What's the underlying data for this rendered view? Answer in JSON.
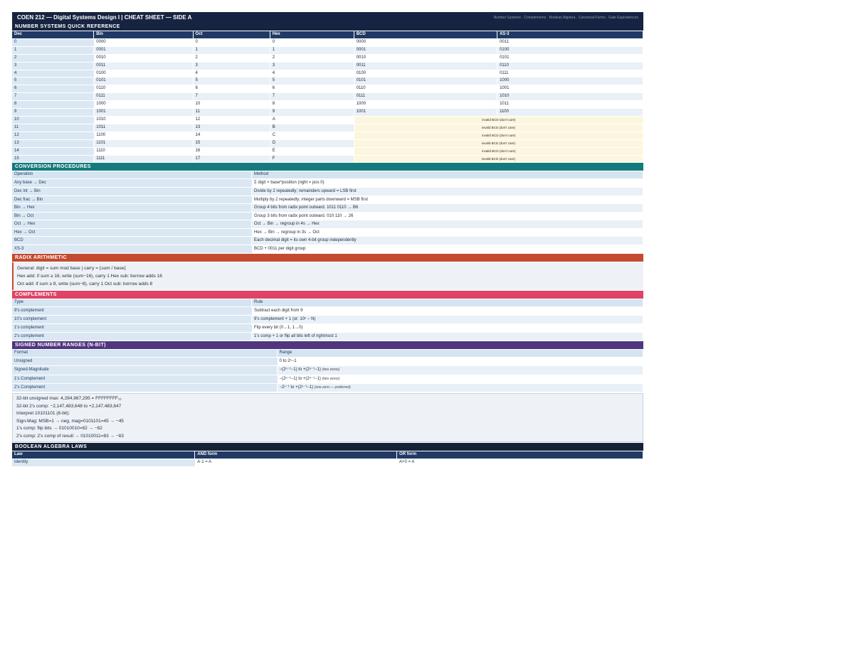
{
  "header": {
    "title": "COEN 212 — Digital Systems Design I  |  CHEAT SHEET — SIDE A",
    "nav": "Number Systems · Complements · Boolean Algebra · Canonical Forms · Gate Equivalences"
  },
  "number_systems": {
    "title": "NUMBER SYSTEMS QUICK REFERENCE",
    "headers": [
      "Dec",
      "Bin",
      "Oct",
      "Hex",
      "BCD",
      "XS-3"
    ],
    "rows": [
      [
        "0",
        "0000",
        "0",
        "0",
        "0000",
        "0011"
      ],
      [
        "1",
        "0001",
        "1",
        "1",
        "0001",
        "0100"
      ],
      [
        "2",
        "0010",
        "2",
        "2",
        "0010",
        "0101"
      ],
      [
        "3",
        "0011",
        "3",
        "3",
        "0011",
        "0110"
      ],
      [
        "4",
        "0100",
        "4",
        "4",
        "0100",
        "0111"
      ],
      [
        "5",
        "0101",
        "5",
        "5",
        "0101",
        "1000"
      ],
      [
        "6",
        "0110",
        "6",
        "6",
        "0110",
        "1001"
      ],
      [
        "7",
        "0111",
        "7",
        "7",
        "0111",
        "1010"
      ],
      [
        "8",
        "1000",
        "10",
        "8",
        "1000",
        "1011"
      ],
      [
        "9",
        "1001",
        "11",
        "9",
        "1001",
        "1100"
      ],
      [
        "10",
        "1010",
        "12",
        "A",
        "invalid BCD (don't care)"
      ],
      [
        "11",
        "1011",
        "13",
        "B",
        "invalid BCD (don't care)"
      ],
      [
        "12",
        "1100",
        "14",
        "C",
        "invalid BCD (don't care)"
      ],
      [
        "13",
        "1101",
        "15",
        "D",
        "invalid BCD (don't care)"
      ],
      [
        "14",
        "1110",
        "16",
        "E",
        "invalid BCD (don't care)"
      ],
      [
        "15",
        "1111",
        "17",
        "F",
        "invalid BCD (don't care)"
      ]
    ]
  },
  "conversion": {
    "title": "CONVERSION PROCEDURES",
    "headers": [
      "Operation",
      "Method"
    ],
    "rows": [
      [
        "Any base → Dec",
        "Σ digit × base^position (right = pos 0)"
      ],
      [
        "Dec int → Bin",
        "Divide by 2 repeatedly; remainders upward = LSB first"
      ],
      [
        "Dec frac → Bin",
        "Multiply by 2 repeatedly; integer parts downward = MSB first"
      ],
      [
        "Bin → Hex",
        "Group 4 bits from radix point outward. 1011 0110 → B6"
      ],
      [
        "Bin → Oct",
        "Group 3 bits from radix point outward. 010 110 → 26"
      ],
      [
        "Oct → Hex",
        "Oct → Bin → regroup in 4s → Hex"
      ],
      [
        "Hex → Oct",
        "Hex → Bin → regroup in 3s → Oct"
      ],
      [
        "BCD",
        "Each decimal digit = its own 4-bit group independently"
      ],
      [
        "XS-3",
        "BCD + 0011 per digit group"
      ]
    ]
  },
  "radix": {
    "title": "RADIX ARITHMETIC",
    "lines": [
      "General: digit = sum mod base  |  carry = ⌊sum / base⌋",
      "Hex add: if sum ≥ 16, write (sum−16), carry 1     Hex sub: borrow adds 16",
      "Oct add: if sum ≥ 8, write (sum−8), carry 1     Oct sub: borrow adds 8"
    ]
  },
  "complements": {
    "title": "COMPLEMENTS",
    "headers": [
      "Type",
      "Rule"
    ],
    "rows": [
      [
        "9's complement",
        "Subtract each digit from 9"
      ],
      [
        "10's complement",
        "9's complement + 1   (or: 10ⁿ − N)"
      ],
      [
        "1's complement",
        "Flip every bit  (0→1, 1→0)"
      ],
      [
        "2's complement",
        "1's comp + 1   or   flip all bits left of rightmost 1"
      ]
    ]
  },
  "signed": {
    "title": "SIGNED NUMBER RANGES (N-BIT)",
    "headers": [
      "Format",
      "Range"
    ],
    "rows": [
      [
        "Unsigned",
        "0 to 2ⁿ−1",
        ""
      ],
      [
        "Signed-Magnitude",
        "−(2ⁿ⁻¹−1) to +(2ⁿ⁻¹−1)",
        "(two zeros)"
      ],
      [
        "1's Complement",
        "−(2ⁿ⁻¹−1) to +(2ⁿ⁻¹−1)",
        "(two zeros)"
      ],
      [
        "2's Complement",
        "−2ⁿ⁻¹ to +(2ⁿ⁻¹−1)",
        "(one zero — preferred)"
      ]
    ],
    "notes": [
      "32-bit unsigned max: 4,294,967,295 = FFFFFFFF₁₆",
      "32-bit 2's comp: −2,147,483,648 to +2,147,483,647",
      "Interpret 10101101 (8-bit):",
      "Sign-Mag: MSB=1 → neg, mag=0101101=45 → −45",
      "1's comp: flip bits → 01010010=82 → −82",
      "2's comp: 2's comp of result → 01010011=83 → −83"
    ]
  },
  "boolean": {
    "title": "BOOLEAN ALGEBRA LAWS",
    "headers": [
      "Law",
      "AND form",
      "OR form"
    ],
    "rows": [
      [
        "Identity",
        "A·1 = A",
        "A+0 = A"
      ]
    ]
  }
}
